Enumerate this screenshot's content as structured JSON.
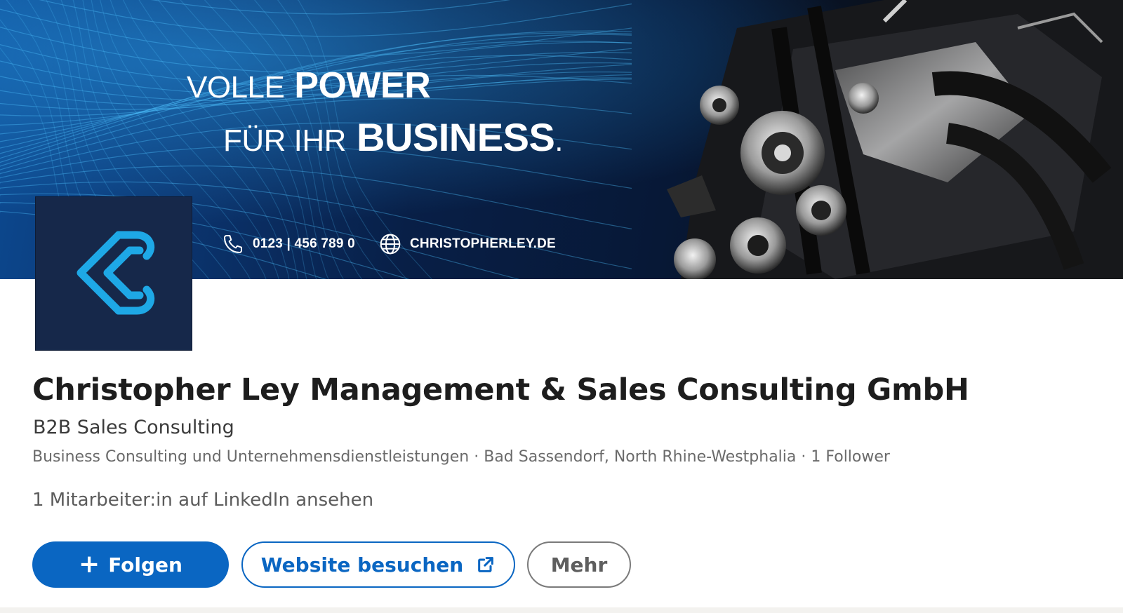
{
  "banner": {
    "headline_line1_light": "VOLLE",
    "headline_line1_bold": "POWER",
    "headline_line2_light": "FÜR IHR",
    "headline_line2_bold": "BUSINESS",
    "headline_line2_end": ".",
    "phone": "0123 | 456 789 0",
    "website": "CHRISTOPHERLEY.DE"
  },
  "company": {
    "name": "Christopher Ley Management & Sales Consulting GmbH",
    "tagline": "B2B Sales Consulting",
    "meta": "Business Consulting und Unternehmensdienstleistungen · Bad Sassendorf, North Rhine-Westphalia · 1 Follower",
    "employees_link": "1 Mitarbeiter:in auf LinkedIn ansehen"
  },
  "actions": {
    "follow_plus": "+",
    "follow_label": "Folgen",
    "website_label": "Website besuchen",
    "more_label": "Mehr"
  },
  "colors": {
    "primary": "#0a66c2",
    "logo_bg": "#16284a",
    "logo_accent": "#1ea8e6"
  },
  "icons": [
    "phone-icon",
    "globe-icon",
    "external-link-icon",
    "company-logo-icon"
  ]
}
